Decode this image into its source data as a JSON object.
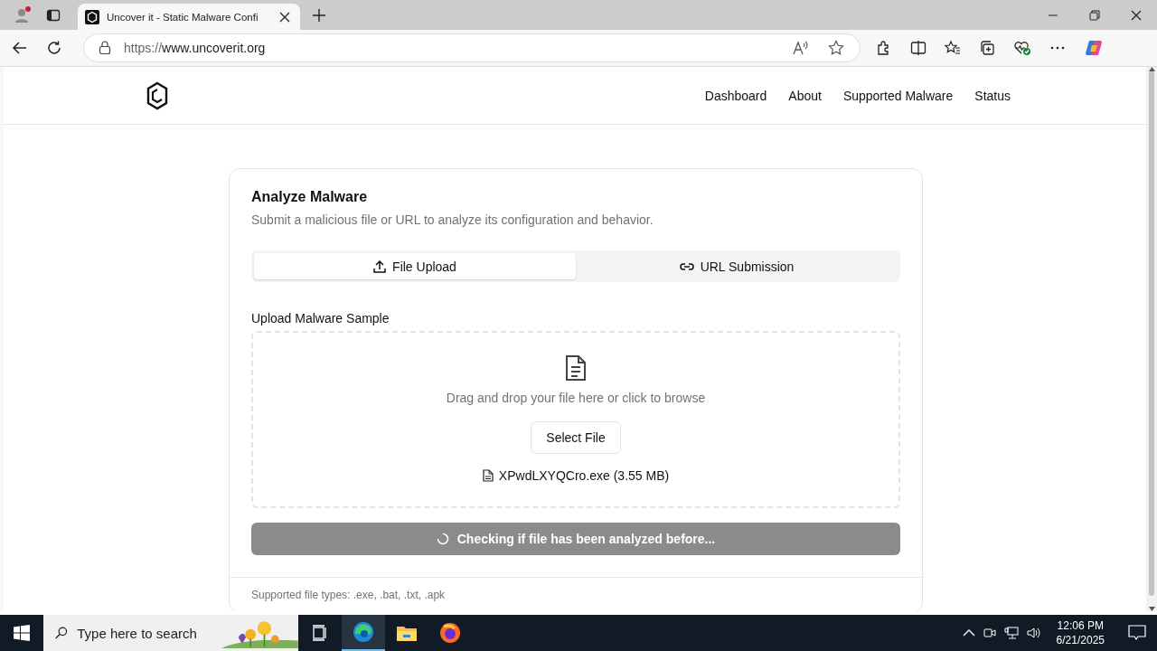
{
  "browser": {
    "tab_title": "Uncover it - Static Malware Confi",
    "url_scheme": "https://",
    "url_host": "www.uncoverit.org"
  },
  "site_nav": [
    "Dashboard",
    "About",
    "Supported Malware",
    "Status"
  ],
  "card": {
    "title": "Analyze Malware",
    "subtitle": "Submit a malicious file or URL to analyze its configuration and behavior.",
    "tabs": [
      {
        "label": "File Upload",
        "selected": true,
        "kind": "upload"
      },
      {
        "label": "URL Submission",
        "selected": false,
        "kind": "link"
      }
    ],
    "upload_label": "Upload Malware Sample",
    "dropzone_text": "Drag and drop your file here or click to browse",
    "select_button": "Select File",
    "selected_file": "XPwdLXYQCro.exe (3.55 MB)",
    "submit": {
      "label": "Checking if file has been analyzed before...",
      "loading": true
    },
    "footer_note": "Supported file types: .exe, .bat, .txt, .apk"
  },
  "taskbar": {
    "search_placeholder": "Type here to search",
    "time": "12:06 PM",
    "date": "6/21/2025"
  }
}
